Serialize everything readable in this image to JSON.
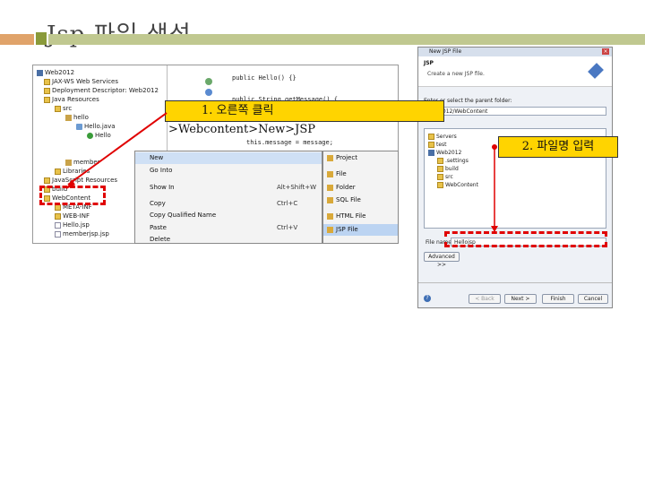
{
  "slide": {
    "title": "Jsp 파일 생성"
  },
  "callouts": {
    "step1_line1": "1. 오른쪽 클릭",
    "step1_line2": ">Webcontent>New>JSP",
    "step2": "2. 파일명 입력"
  },
  "project_tree": {
    "items": [
      {
        "label": "Web2012",
        "icon": "project-icon"
      },
      {
        "label": "JAX-WS Web Services",
        "icon": "folder-icon"
      },
      {
        "label": "Deployment Descriptor: Web2012",
        "icon": "folder-icon"
      },
      {
        "label": "Java Resources",
        "icon": "folder-icon"
      },
      {
        "label": "src",
        "icon": "folder-icon"
      },
      {
        "label": "hello",
        "icon": "package-icon"
      },
      {
        "label": "Hello.java",
        "icon": "java-file-icon"
      },
      {
        "label": "Hello",
        "icon": "class-icon"
      },
      {
        "label": "member",
        "icon": "package-icon"
      },
      {
        "label": "Libraries",
        "icon": "folder-icon"
      },
      {
        "label": "JavaScript Resources",
        "icon": "folder-icon"
      },
      {
        "label": "build",
        "icon": "folder-icon"
      },
      {
        "label": "WebContent",
        "icon": "folder-icon"
      },
      {
        "label": "META-INF",
        "icon": "folder-icon"
      },
      {
        "label": "WEB-INF",
        "icon": "folder-icon"
      },
      {
        "label": "Hello.jsp",
        "icon": "file-icon"
      },
      {
        "label": "memberjsp.jsp",
        "icon": "file-icon"
      }
    ]
  },
  "code": {
    "lines": [
      "public Hello() {}",
      "public String getMessage() {",
      "this.message = message;"
    ]
  },
  "context_menu": {
    "items": [
      {
        "label": "New",
        "shortcut": ""
      },
      {
        "label": "Go Into",
        "shortcut": ""
      },
      {
        "label": "Show In",
        "shortcut": "Alt+Shift+W"
      },
      {
        "label": "Copy",
        "shortcut": "Ctrl+C"
      },
      {
        "label": "Copy Qualified Name",
        "shortcut": ""
      },
      {
        "label": "Paste",
        "shortcut": "Ctrl+V"
      },
      {
        "label": "Delete",
        "shortcut": ""
      }
    ]
  },
  "submenu": {
    "items": [
      {
        "label": "Project"
      },
      {
        "label": "File"
      },
      {
        "label": "Folder"
      },
      {
        "label": "SQL File"
      },
      {
        "label": "HTML File"
      },
      {
        "label": "JSP File"
      }
    ]
  },
  "dialog": {
    "title": "New JSP File",
    "header_title": "JSP",
    "header_desc": "Create a new JSP file.",
    "parent_label": "Enter or select the parent folder:",
    "parent_value": "Web2012/WebContent",
    "tree": [
      {
        "label": "Servers"
      },
      {
        "label": "test"
      },
      {
        "label": "Web2012"
      },
      {
        "label": ".settings"
      },
      {
        "label": "build"
      },
      {
        "label": "src"
      },
      {
        "label": "WebContent"
      }
    ],
    "file_name_label": "File name:",
    "file_name_value": "Hellojsp",
    "advanced_button": "Advanced >>",
    "back_button": "< Back",
    "next_button": "Next >",
    "finish_button": "Finish",
    "cancel_button": "Cancel"
  },
  "colors": {
    "callout_fill": "#ffd400",
    "highlight_box": "#e00000",
    "title_band": "#c0c890"
  }
}
